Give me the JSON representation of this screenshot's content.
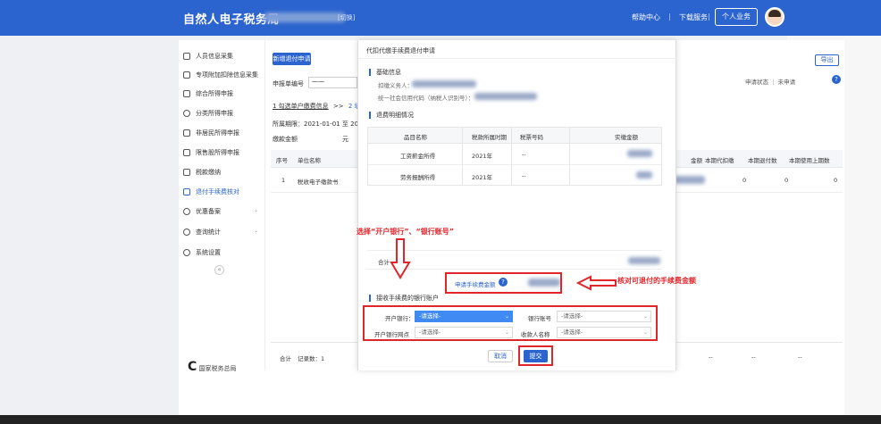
{
  "header": {
    "brand": "自然人电子税务局",
    "switch": "[切换]",
    "help": "帮助中心",
    "separator": "|",
    "download": "下载服务",
    "personal": "个人业务"
  },
  "sidebar": {
    "items": [
      {
        "label": "人员信息采集",
        "icon": "user-icon"
      },
      {
        "label": "专项附加扣除信息采集",
        "icon": "form-icon"
      },
      {
        "label": "综合所得申报",
        "icon": "layers-icon"
      },
      {
        "label": "分类所得申报",
        "icon": "clock-icon"
      },
      {
        "label": "非居民所得申报",
        "icon": "person-icon"
      },
      {
        "label": "限售股所得申报",
        "icon": "chart-icon"
      },
      {
        "label": "税款缴纳",
        "icon": "folder-icon"
      },
      {
        "label": "退付手续费核对",
        "icon": "doc-icon"
      },
      {
        "label": "查询统计",
        "icon": "search-icon"
      },
      {
        "label": "系统设置",
        "icon": "gear-icon"
      }
    ],
    "optional": "优惠备案",
    "collapse": "«",
    "bottom_logo": "国家税务总局"
  },
  "main": {
    "new_button": "新增退付申请",
    "apply_no_label": "申报单编号",
    "apply_no_value": "一一",
    "step1": "1 勾选单户缴费信息",
    "step_sep": ">>",
    "step2": "2 填",
    "period_label": "所属期限",
    "period_value": "2021-01-01 至 2021",
    "amount_label": "缴款金额",
    "amount_unit": "元",
    "export": "导出",
    "status_label": "申请状态",
    "status_value": "未申请",
    "help_icon": "?",
    "table_headers": [
      "序号",
      "单位名称",
      "金额",
      "本期代扣缴",
      "本期退付数",
      "本期使用上期数"
    ],
    "table_row": {
      "no": "1",
      "name": "税收电子缴款书",
      "c1": "0",
      "c2": "0",
      "c3": "0"
    },
    "bottom_total": "合计",
    "bottom_count": "记录数：1",
    "dash": "--"
  },
  "modal": {
    "title": "代扣代缴手续费退付申请",
    "section_basic": "基础信息",
    "withholder_label": "扣缴义务人：",
    "credit_code_label": "统一社会信用代码（纳税人识别号）：",
    "section_refund": "退费明细情况",
    "table_headers": [
      "品目名称",
      "税款所属时期",
      "税票号码",
      "实缴金额"
    ],
    "rows": [
      {
        "item": "工资薪金所得",
        "period": "2021年",
        "ticket": "--"
      },
      {
        "item": "劳务报酬所得",
        "period": "2021年",
        "ticket": "--"
      }
    ],
    "total_label": "合计",
    "refund_label": "申请手续费金额",
    "help_icon": "?",
    "section_account": "接收手续费的银行账户",
    "bank_label": "开户银行：",
    "bank_value": "-请选择-",
    "account_label": "银行账号",
    "account_value": "-请选择-",
    "outlet_label": "开户银行网点",
    "outlet_value": "-请选择-",
    "payee_label": "收款人名称",
    "payee_value": "-请选择-",
    "cancel": "取消",
    "submit": "提交"
  },
  "annotations": {
    "select_hint": "选择“开户银行”、“银行账号”",
    "check_hint": "核对可退付的手续费金额",
    "color": "#e0262b"
  }
}
